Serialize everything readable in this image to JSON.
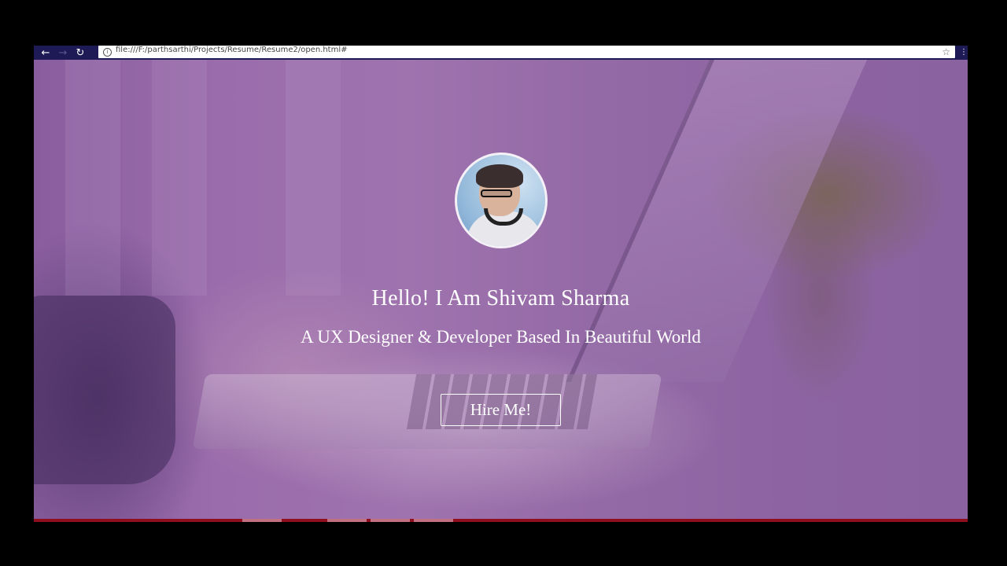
{
  "browser": {
    "back_icon": "arrow-left-icon",
    "forward_icon": "arrow-right-icon",
    "reload_icon": "reload-icon",
    "info_icon": "info-icon",
    "address_url": "file:///F:/parthsarthi/Projects/Resume/Resume2/open.html#",
    "bookmark_icon": "star-icon",
    "menu_icon": "menu-icon"
  },
  "hero": {
    "avatar_icon": "profile-photo",
    "title": "Hello! I Am Shivam Sharma",
    "subtitle": "A UX Designer & Developer Based In Beautiful World",
    "cta_label": "Hire Me!"
  },
  "colors": {
    "overlay": "#9a6cab",
    "text": "#ffffff",
    "browser_bar": "#1e1a55",
    "taskbar": "#8f0f1e"
  }
}
